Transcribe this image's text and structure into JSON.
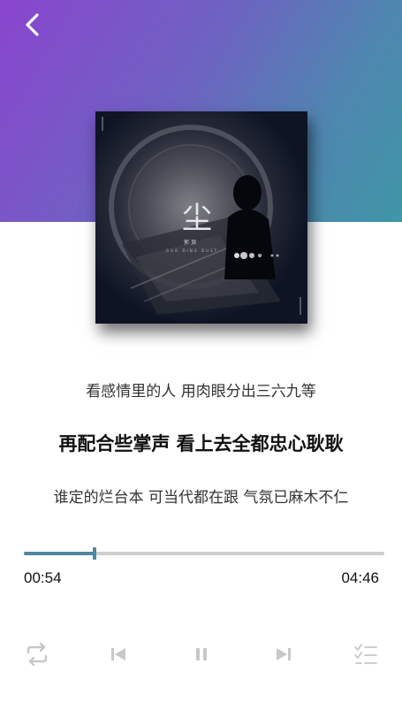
{
  "player": {
    "cover_title": "尘",
    "cover_artist": "郭 頂",
    "cover_subtitle": "GUO DING DUST"
  },
  "lyrics": {
    "previous": "看感情里的人 用肉眼分出三六九等",
    "current": "再配合些掌声 看上去全都忠心耿耿",
    "next": "谁定的烂台本 可当代都在跟 气氛已麻木不仁"
  },
  "progress": {
    "current_time": "00:54",
    "total_time": "04:46",
    "fraction": 0.196
  },
  "icons": {
    "back": "chevron-left-icon",
    "repeat": "repeat-icon",
    "previous": "skip-previous-icon",
    "pause": "pause-icon",
    "next": "skip-next-icon",
    "playlist": "playlist-icon"
  },
  "colors": {
    "accent": "#4f86a0",
    "gradient_start": "#8a45cf",
    "gradient_end": "#3f96a6",
    "control_icon": "#c8c8c8"
  }
}
